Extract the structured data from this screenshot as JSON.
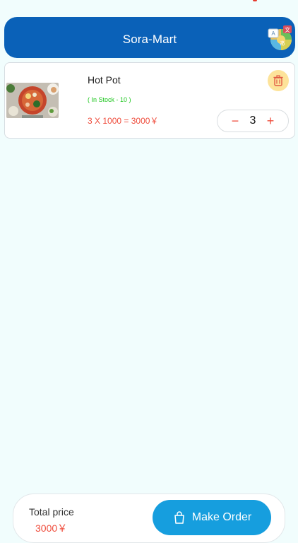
{
  "header": {
    "title": "Sora-Mart",
    "translate_icon": "translate-language-icon"
  },
  "cart": {
    "items": [
      {
        "name": "Hot Pot",
        "stock_text": "( In Stock - 10 )",
        "price_formula": "3 X 1000 = 3000￥",
        "quantity": "3",
        "decrement_label": "−",
        "increment_label": "+",
        "delete_icon": "trash-icon"
      }
    ]
  },
  "footer": {
    "total_label": "Total price",
    "total_value": "3000￥",
    "order_button_label": "Make Order",
    "order_button_icon": "shopping-bag-icon"
  },
  "colors": {
    "header_blue": "#0a61b8",
    "accent_red": "#ef4d3d",
    "stock_green": "#19c51a",
    "order_button_blue": "#169ede",
    "delete_bg": "#fde39a",
    "page_bg": "#f1fdfd"
  }
}
